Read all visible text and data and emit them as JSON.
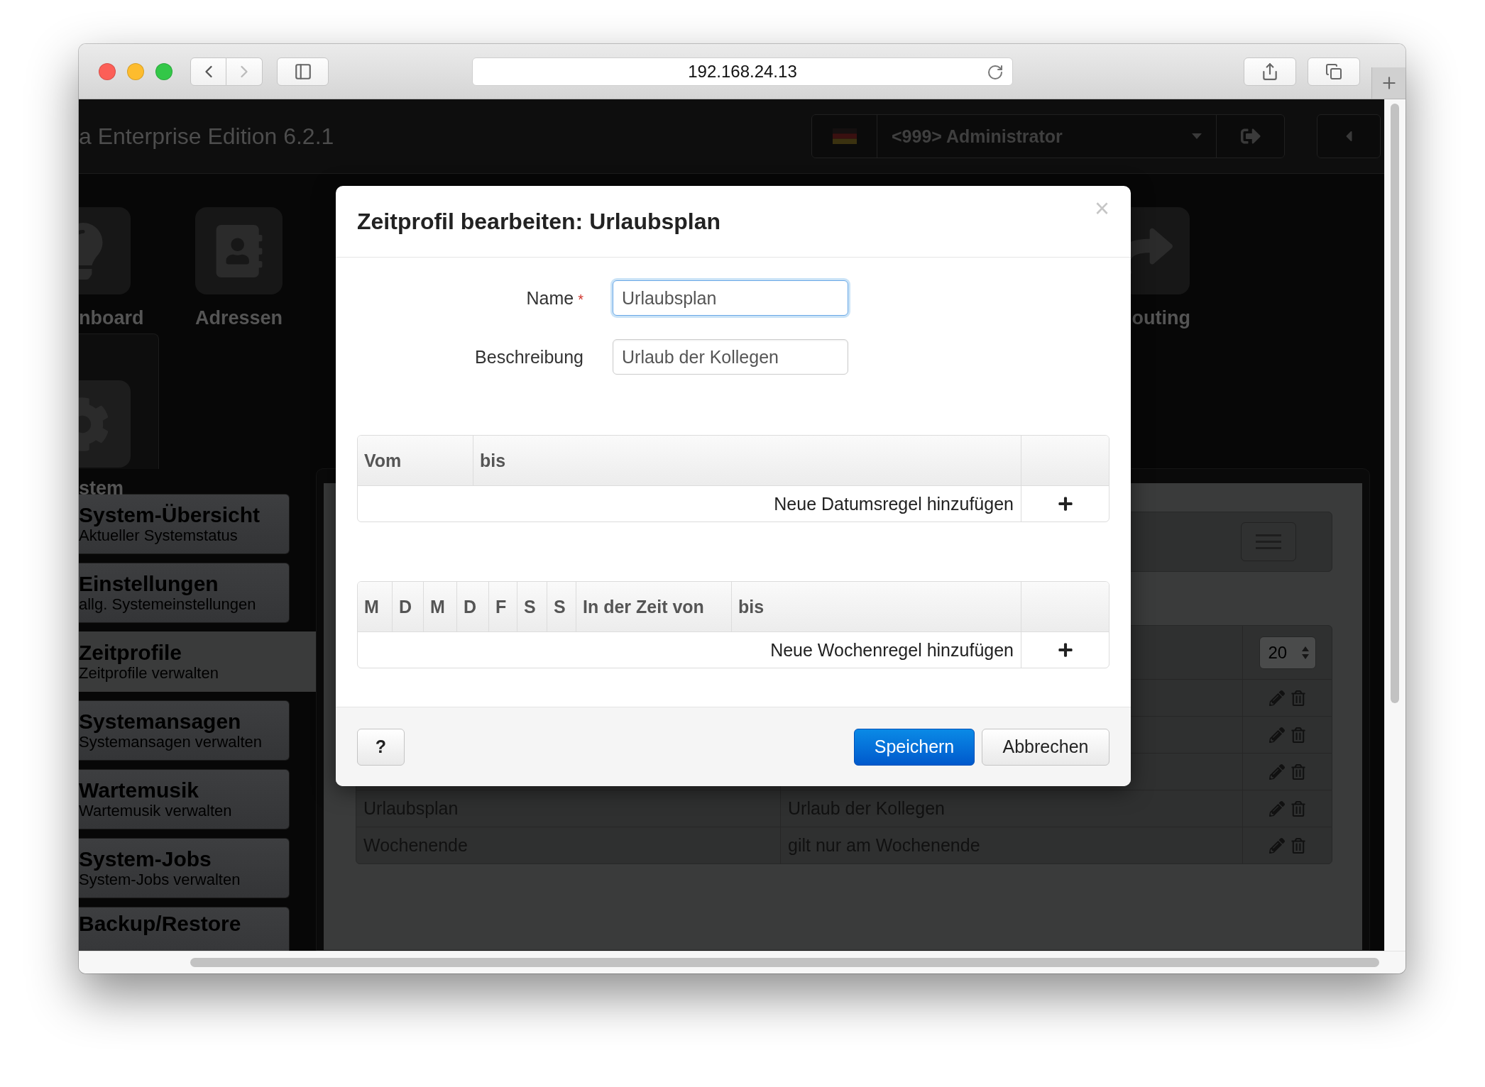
{
  "browser": {
    "url": "192.168.24.13"
  },
  "header": {
    "title": "a Enterprise Edition 6.2.1",
    "user": "<999> Administrator"
  },
  "launcher_row_1": [
    {
      "label": "nboard",
      "kind": "bulb"
    },
    {
      "label": "Adressen",
      "kind": "addressbook"
    },
    {
      "label": "outing",
      "kind": "routing"
    }
  ],
  "launcher_row_2": [
    {
      "label": "stem",
      "kind": "gear",
      "selected": true
    }
  ],
  "sidebar": [
    {
      "title": "System-Übersicht",
      "subtitle": "Aktueller Systemstatus",
      "selected": false
    },
    {
      "title": "Einstellungen",
      "subtitle": "allg. Systemeinstellungen",
      "selected": false
    },
    {
      "title": "Zeitprofile",
      "subtitle": "Zeitprofile verwalten",
      "selected": true
    },
    {
      "title": "Systemansagen",
      "subtitle": "Systemansagen verwalten",
      "selected": false
    },
    {
      "title": "Wartemusik",
      "subtitle": "Wartemusik verwalten",
      "selected": false
    },
    {
      "title": "System-Jobs",
      "subtitle": "System-Jobs verwalten",
      "selected": false
    },
    {
      "title": "Backup/Restore",
      "selected": false
    }
  ],
  "table": {
    "page_size": "20",
    "rows": [
      {},
      {},
      {},
      {
        "name": "Urlaubsplan",
        "description": "Urlaub der Kollegen"
      },
      {
        "name": "Wochenende",
        "description": "gilt nur am Wochenende"
      }
    ]
  },
  "dialog": {
    "title": "Zeitprofil bearbeiten: Urlaubsplan",
    "close": "×",
    "fields": [
      {
        "label": "Name",
        "required_mark": "*",
        "value": "Urlaubsplan",
        "focused": true
      },
      {
        "label": "Beschreibung",
        "value": "Urlaub der Kollegen",
        "focused": false
      }
    ],
    "date_rules": {
      "columns": [
        "Vom",
        "bis"
      ],
      "add_label": "Neue Datumsregel hinzufügen"
    },
    "week_rules": {
      "columns": [
        "M",
        "D",
        "M",
        "D",
        "F",
        "S",
        "S",
        "In der Zeit von",
        "bis"
      ],
      "add_label": "Neue Wochenregel hinzufügen"
    },
    "buttons": [
      {
        "label": "?",
        "kind": "help"
      },
      {
        "label": "Speichern",
        "kind": "primary"
      },
      {
        "label": "Abbrechen",
        "kind": "default"
      }
    ]
  }
}
